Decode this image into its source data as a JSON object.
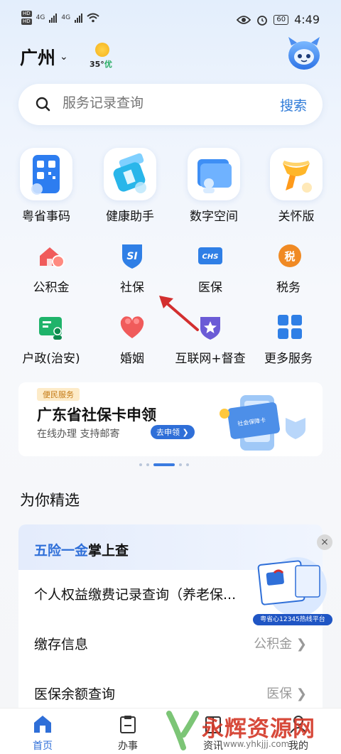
{
  "status_bar": {
    "hd_labels": [
      "HD",
      "HD"
    ],
    "net_labels": [
      "4G",
      "4G"
    ],
    "battery": "60",
    "time": "4:49"
  },
  "header": {
    "city": "广州",
    "weather_temp": "35°",
    "weather_quality": "优"
  },
  "search": {
    "placeholder": "服务记录查询",
    "button": "搜索"
  },
  "primary_services": [
    {
      "label": "粤省事码",
      "icon": "qr-code-phone-icon"
    },
    {
      "label": "健康助手",
      "icon": "health-bag-icon"
    },
    {
      "label": "数字空间",
      "icon": "folder-user-icon"
    },
    {
      "label": "关怀版",
      "icon": "care-scarf-icon"
    }
  ],
  "services": [
    {
      "label": "公积金",
      "icon": "house-coin-icon"
    },
    {
      "label": "社保",
      "icon": "si-shield-icon"
    },
    {
      "label": "医保",
      "icon": "chs-card-icon"
    },
    {
      "label": "税务",
      "icon": "tax-icon"
    },
    {
      "label": "户政(治安)",
      "icon": "id-card-icon"
    },
    {
      "label": "婚姻",
      "icon": "heart-icon"
    },
    {
      "label": "互联网+督查",
      "icon": "star-shield-icon"
    },
    {
      "label": "更多服务",
      "icon": "grid-icon"
    }
  ],
  "banner": {
    "tag": "便民服务",
    "title": "广东省社保卡申领",
    "subtitle": "在线办理 支持邮寄",
    "button": "去申领",
    "card_text": "社会保障卡"
  },
  "carousel": {
    "count": 5,
    "active": 2
  },
  "section_title": "为你精选",
  "card": {
    "title_highlight": "五险一金",
    "title_rest": "掌上查",
    "rows": [
      {
        "label": "个人权益缴费记录查询（养老保...",
        "right": ""
      },
      {
        "label": "缴存信息",
        "right": "公积金"
      },
      {
        "label": "医保余额查询",
        "right": "医保"
      }
    ]
  },
  "promo": {
    "text": "粤省心12345热线平台",
    "close": "×"
  },
  "tabs": [
    {
      "label": "首页",
      "active": true
    },
    {
      "label": "办事",
      "active": false
    },
    {
      "label": "资讯",
      "active": false
    },
    {
      "label": "我的",
      "active": false
    }
  ],
  "watermark": {
    "text": "永辉资源网",
    "url": "www.yhkjjj.com"
  },
  "colors": {
    "accent": "#2f6fd8",
    "arrow": "#d32f2f"
  }
}
